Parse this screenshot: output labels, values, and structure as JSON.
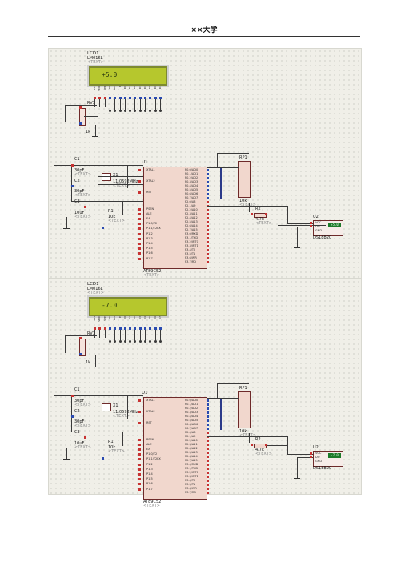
{
  "page_header": {
    "title": "××大学"
  },
  "diagrams": [
    {
      "lcd": {
        "ref": "LCD1",
        "model": "LM016L",
        "placeholder": "<TEXT>",
        "display": "+5.0"
      },
      "pot": {
        "ref": "RV1",
        "value": "1k"
      },
      "cap1": {
        "ref": "C1",
        "value": "30pF",
        "placeholder": "<TEXT>"
      },
      "cap2": {
        "ref": "C2",
        "value": "30pF",
        "placeholder": "<TEXT>"
      },
      "crystal": {
        "ref": "X1",
        "value": "11.0592MHz",
        "placeholder": "<TEXT>"
      },
      "cap3": {
        "ref": "C3",
        "value": "10uF",
        "placeholder": "<TEXT>"
      },
      "r1": {
        "ref": "R1",
        "value": "10k",
        "placeholder": "<TEXT>"
      },
      "mcu": {
        "ref": "U1",
        "model": "AT89C52",
        "placeholder": "<TEXT>"
      },
      "rp1": {
        "ref": "RP1",
        "value": "10k",
        "placeholder": "<TEXT>"
      },
      "r2": {
        "ref": "R2",
        "value": "4.7k",
        "placeholder": "<TEXT>"
      },
      "sensor": {
        "ref": "U2",
        "model": "DS18B20",
        "reading": "+5.0"
      }
    },
    {
      "lcd": {
        "ref": "LCD1",
        "model": "LM016L",
        "placeholder": "<TEXT>",
        "display": "-7.0"
      },
      "pot": {
        "ref": "RV1",
        "value": "1k"
      },
      "cap1": {
        "ref": "C1",
        "value": "30pF",
        "placeholder": "<TEXT>"
      },
      "cap2": {
        "ref": "C2",
        "value": "30pF",
        "placeholder": "<TEXT>"
      },
      "crystal": {
        "ref": "X1",
        "value": "11.0592MHz",
        "placeholder": "<TEXT>"
      },
      "cap3": {
        "ref": "C3",
        "value": "10uF",
        "placeholder": "<TEXT>"
      },
      "r1": {
        "ref": "R1",
        "value": "10k",
        "placeholder": "<TEXT>"
      },
      "mcu": {
        "ref": "U1",
        "model": "AT89C52",
        "placeholder": "<TEXT>"
      },
      "rp1": {
        "ref": "RP1",
        "value": "10k",
        "placeholder": "<TEXT>"
      },
      "r2": {
        "ref": "R2",
        "value": "4.7k",
        "placeholder": "<TEXT>"
      },
      "sensor": {
        "ref": "U2",
        "model": "DS18B20",
        "reading": "-7.0"
      }
    }
  ],
  "mcu_pins_left": [
    "XTAL1",
    "XTAL2",
    "RST",
    "PSEN",
    "ALE",
    "EA",
    "P1.0/T2",
    "P1.1/T2EX",
    "P1.2",
    "P1.3",
    "P1.4",
    "P1.5",
    "P1.6",
    "P1.7"
  ],
  "mcu_pins_right": [
    "P0.0/AD0",
    "P0.1/AD1",
    "P0.2/AD2",
    "P0.3/AD3",
    "P0.4/AD4",
    "P0.5/AD5",
    "P0.6/AD6",
    "P0.7/AD7",
    "P2.0/A8",
    "P2.1/A9",
    "P2.2/A10",
    "P2.3/A11",
    "P2.4/A12",
    "P2.5/A13",
    "P2.6/A14",
    "P2.7/A15",
    "P3.0/RXD",
    "P3.1/TXD",
    "P3.2/INT0",
    "P3.3/INT1",
    "P3.4/T0",
    "P3.5/T1",
    "P3.6/WR",
    "P3.7/RD"
  ],
  "sensor_pins": [
    "VCC",
    "DQ",
    "GND"
  ],
  "lcd_pins": [
    "VSS",
    "VDD",
    "VEE",
    "RS",
    "RW",
    "E",
    "D0",
    "D1",
    "D2",
    "D3",
    "D4",
    "D5",
    "D6",
    "D7"
  ]
}
